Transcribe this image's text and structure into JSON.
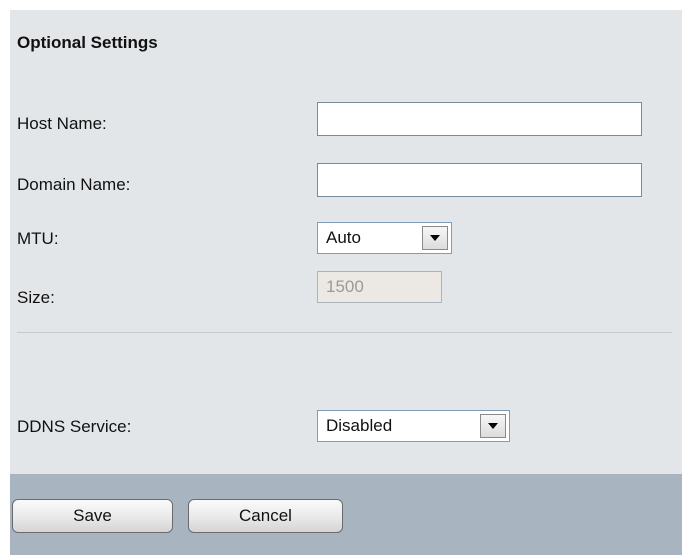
{
  "section": {
    "title": "Optional Settings"
  },
  "fields": {
    "host_name": {
      "label": "Host Name:",
      "value": ""
    },
    "domain_name": {
      "label": "Domain Name:",
      "value": ""
    },
    "mtu": {
      "label": "MTU:",
      "selected": "Auto"
    },
    "size": {
      "label": "Size:",
      "value": "1500"
    },
    "ddns_service": {
      "label": "DDNS Service:",
      "selected": "Disabled"
    }
  },
  "buttons": {
    "save_label": "Save",
    "cancel_label": "Cancel"
  },
  "icons": {
    "dropdown": "chevron-down-icon"
  },
  "colors": {
    "panel_background": "#e3e6e9",
    "footer_background": "#a8b5c1",
    "disabled_field": "#ece9e4"
  }
}
